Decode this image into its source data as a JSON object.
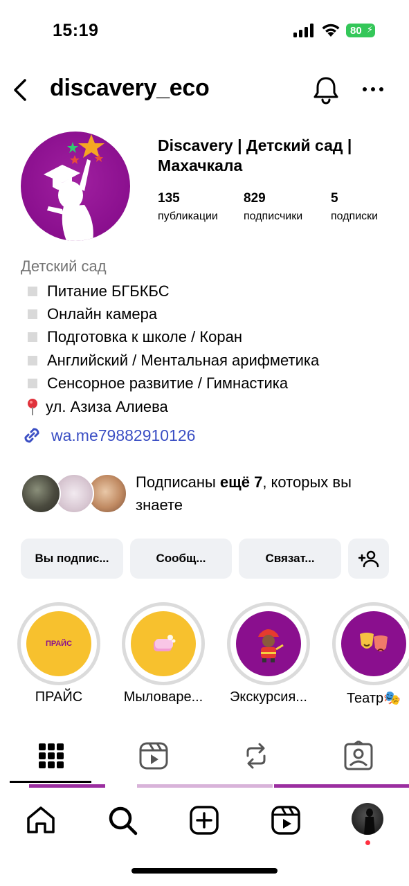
{
  "status_bar": {
    "time": "15:19",
    "battery": "80"
  },
  "header": {
    "username": "discavery_eco"
  },
  "profile": {
    "display_name": "Discavery | Детский сад | Махачкала",
    "stats": [
      {
        "value": "135",
        "label": "публикации"
      },
      {
        "value": "829",
        "label": "подписчики"
      },
      {
        "value": "5",
        "label": "подписки"
      }
    ]
  },
  "bio": {
    "category": "Детский сад",
    "lines": [
      "Питание БГБКБС",
      "Онлайн камера",
      "Подготовка к школе / Коран",
      "Английский / Ментальная арифметика",
      "Сенсорное развитие / Гимнастика"
    ],
    "location": "ул. Азиза Алиева",
    "link": "wa.me79882910126"
  },
  "mutuals": {
    "prefix": "Подписаны ",
    "bold": "ещё 7",
    "suffix": ", которых вы знаете"
  },
  "actions": {
    "following": "Вы подпис...",
    "message": "Сообщ...",
    "contact": "Связат..."
  },
  "highlights": [
    {
      "label": "ПРАЙС",
      "cover_text": "ПРАЙС",
      "cover_color": "#f7c12e"
    },
    {
      "label": "Мыловаре...",
      "cover_color": "#f7c12e"
    },
    {
      "label": "Экскурсия...",
      "cover_color": "#8a0f8e"
    },
    {
      "label": "Театр🎭",
      "cover_color": "#8a0f8e"
    }
  ],
  "tabs": [
    "grid-icon",
    "reels-icon",
    "reposts-icon",
    "tagged-icon"
  ],
  "colors": {
    "brand_purple": "#8a0f8e",
    "link_blue": "#3b4fc4",
    "battery_green": "#34c759"
  }
}
